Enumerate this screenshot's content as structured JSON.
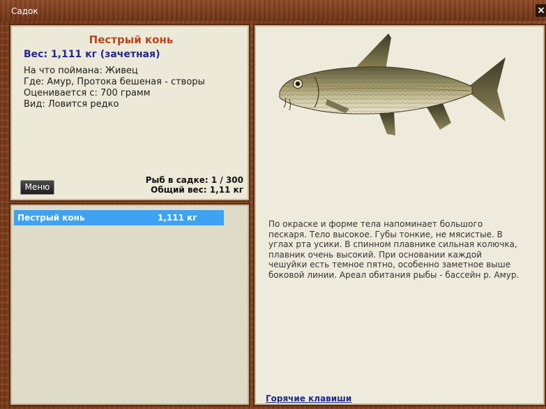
{
  "window": {
    "title": "Садок",
    "close_label": "×"
  },
  "fish": {
    "name": "Пестрый конь",
    "weight_line": "Вес: 1,111 кг (зачетная)",
    "details": [
      "На что поймана: Живец",
      "Где: Амур, Протока бешеная - створы",
      "Оценивается с: 700 грамм",
      "Вид: Ловится редко"
    ],
    "description": "По окраске и форме тела напоминает большого пескаря. Тело высокое. Губы тонкие, не мясистые. В углах рта усики. В спинном плавнике сильная колючка, плавник очень высокий. При основании каждой чешуйки есть темное пятно, особенно заметное выше боковой линии. Ареал обитания рыбы - бассейн р. Амур."
  },
  "menu_button": {
    "label": "Меню"
  },
  "stats": {
    "count": "Рыб в садке: 1 / 300",
    "total_weight": "Общий вес: 1,11 кг"
  },
  "catch_list": [
    {
      "name": "Пестрый конь",
      "weight": "1,111 кг"
    }
  ],
  "links": {
    "hotkeys": "Горячие клавиши"
  },
  "colors": {
    "title_accent": "#b8451a",
    "weight_accent": "#1f2a88",
    "selection": "#3fa3f3",
    "wood": "#8a4422"
  },
  "icons": {
    "close": "close-icon",
    "fish": "fish-illustration"
  }
}
